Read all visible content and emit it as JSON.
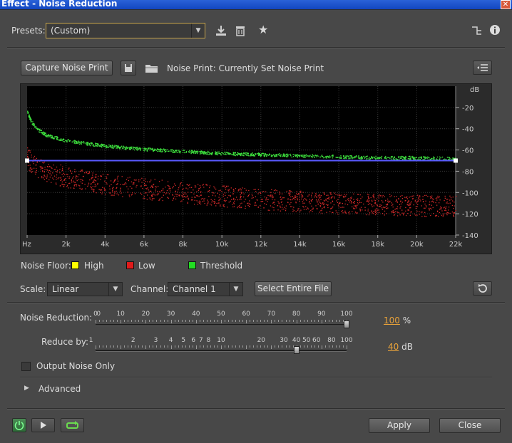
{
  "window": {
    "title": "Effect - Noise Reduction"
  },
  "presets": {
    "label": "Presets:",
    "value": "(Custom)"
  },
  "toolbar": {
    "capture_label": "Capture Noise Print",
    "noise_print_label": "Noise Print:",
    "noise_print_value": "Currently Set Noise Print"
  },
  "chart_data": {
    "type": "scatter",
    "y_unit_label": "dB",
    "x_ticks": [
      "Hz",
      "2k",
      "4k",
      "6k",
      "8k",
      "10k",
      "12k",
      "14k",
      "16k",
      "18k",
      "20k",
      "22k"
    ],
    "y_ticks": [
      "-20",
      "-40",
      "-60",
      "-80",
      "-100",
      "-120",
      "-140"
    ],
    "xlim": [
      0,
      22000
    ],
    "ylim": [
      -140,
      0
    ],
    "series": [
      {
        "color": "#3ee03e",
        "shape": "noise-floor-high",
        "x": [
          0,
          200,
          500,
          1000,
          2000,
          4000,
          6000,
          8000,
          10000,
          12000,
          14000,
          16000,
          18000,
          20000,
          22000
        ],
        "y": [
          -24,
          -33,
          -40,
          -46,
          -51,
          -56,
          -59,
          -61,
          -63,
          -64,
          -65,
          -66,
          -67,
          -67,
          -68
        ]
      },
      {
        "color": "#d42a2a",
        "shape": "noise-floor-low",
        "x": [
          0,
          200,
          500,
          1000,
          2000,
          4000,
          6000,
          8000,
          10000,
          12000,
          14000,
          16000,
          18000,
          20000,
          22000
        ],
        "y": [
          -66,
          -72,
          -76,
          -80,
          -85,
          -92,
          -96,
          -100,
          -103,
          -106,
          -108,
          -110,
          -111,
          -112,
          -113
        ]
      },
      {
        "color": "#5a5aff",
        "shape": "threshold-line",
        "x": [
          0,
          22000
        ],
        "y": [
          -70,
          -70
        ]
      }
    ]
  },
  "legend": {
    "prefix": "Noise Floor:",
    "items": [
      {
        "label": "High",
        "color": "#ffff00"
      },
      {
        "label": "Low",
        "color": "#e01a1a"
      },
      {
        "label": "Threshold",
        "color": "#22dd22"
      }
    ]
  },
  "scale": {
    "label": "Scale:",
    "value": "Linear"
  },
  "channel": {
    "label": "Channel:",
    "value": "Channel 1"
  },
  "select_file_label": "Select Entire File",
  "noise_reduction": {
    "label": "Noise Reduction:",
    "ticks": [
      "0",
      "0",
      "10",
      "20",
      "30",
      "40",
      "50",
      "60",
      "70",
      "80",
      "90",
      "100"
    ],
    "value": "100",
    "unit": "%",
    "fraction": 1.0
  },
  "reduce_by": {
    "label": "Reduce by:",
    "ticks": [
      "1",
      "2",
      "3",
      "4",
      "5",
      "6",
      "7",
      "8",
      "10",
      "20",
      "30",
      "40",
      "50",
      "60",
      "80",
      "100"
    ],
    "value": "40",
    "unit": "dB",
    "fraction": 0.8
  },
  "output_noise": {
    "label": "Output Noise Only",
    "checked": false
  },
  "advanced": {
    "label": "Advanced"
  },
  "footer": {
    "apply_label": "Apply",
    "close_label": "Close"
  }
}
